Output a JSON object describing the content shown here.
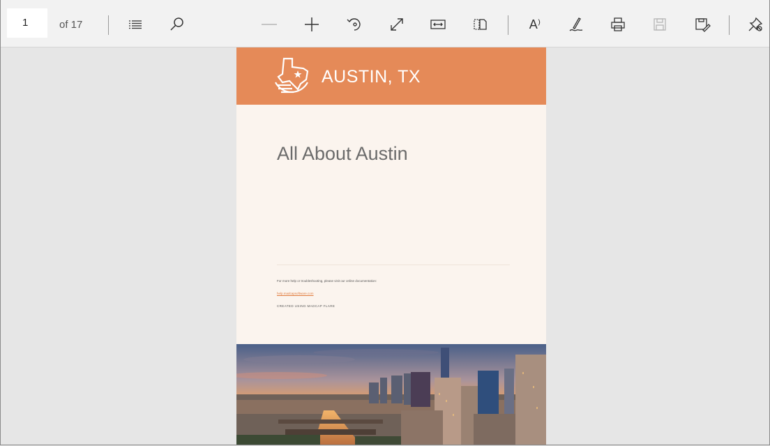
{
  "toolbar": {
    "page_number": "1",
    "page_count": "of 17",
    "tools": [
      {
        "name": "contents-icon"
      },
      {
        "name": "search-icon"
      },
      {
        "name": "zoom-out-icon"
      },
      {
        "name": "zoom-in-icon"
      },
      {
        "name": "rotate-icon"
      },
      {
        "name": "fullscreen-icon"
      },
      {
        "name": "fit-width-icon"
      },
      {
        "name": "page-view-icon"
      },
      {
        "name": "read-aloud-icon"
      },
      {
        "name": "draw-icon"
      },
      {
        "name": "print-icon"
      },
      {
        "name": "save-icon"
      },
      {
        "name": "save-as-icon"
      },
      {
        "name": "pin-icon"
      }
    ],
    "read_aloud_glyph": "A⁾"
  },
  "document": {
    "city": "AUSTIN, TX",
    "title": "All About Austin",
    "help_text": "For more help or troubleshooting, please visit our online documentation:",
    "help_link": "help.madcapsoftware.com",
    "created_text": "CREATED USING MADCAP FLARE"
  },
  "colors": {
    "header": "#e58a58",
    "page_bg": "#fbf4ee",
    "viewer_bg": "#e6e6e6",
    "toolbar_bg": "#f2f2f2",
    "link": "#e07a3c"
  }
}
